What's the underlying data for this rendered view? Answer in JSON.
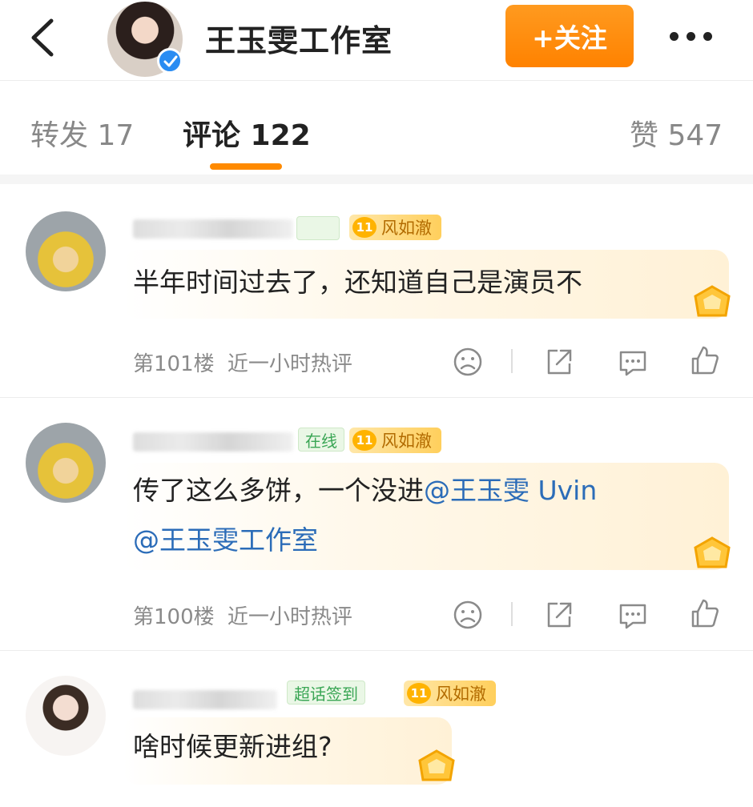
{
  "header": {
    "title": "王玉雯工作室",
    "follow_label": "+关注",
    "accent": "#ff8a00"
  },
  "tabs": [
    {
      "label": "转发 17"
    },
    {
      "label": "评论 122"
    },
    {
      "label": "赞 547"
    }
  ],
  "comments": [
    {
      "badge": "",
      "level": "11",
      "level_title": "风如澈",
      "text": "半年时间过去了，还知道自己是演员不",
      "floor": "第101楼",
      "hot": "近一小时热评"
    },
    {
      "badge": "在线",
      "level": "11",
      "level_title": "风如澈",
      "text_plain": "传了这么多饼，一个没进",
      "mention_1": "@王玉雯 Uvin",
      "mention_2": "@王玉雯工作室",
      "floor": "第100楼",
      "hot": "近一小时热评"
    },
    {
      "badge": "超话签到",
      "level": "11",
      "level_title": "风如澈",
      "text": "啥时候更新进组?"
    }
  ],
  "icons": {
    "back": "chevron-left-icon",
    "more": "more-dots-icon",
    "verified": "verified-icon",
    "sad": "sad-face-icon",
    "share": "share-icon",
    "reply": "comment-icon",
    "like": "thumbs-up-icon"
  }
}
